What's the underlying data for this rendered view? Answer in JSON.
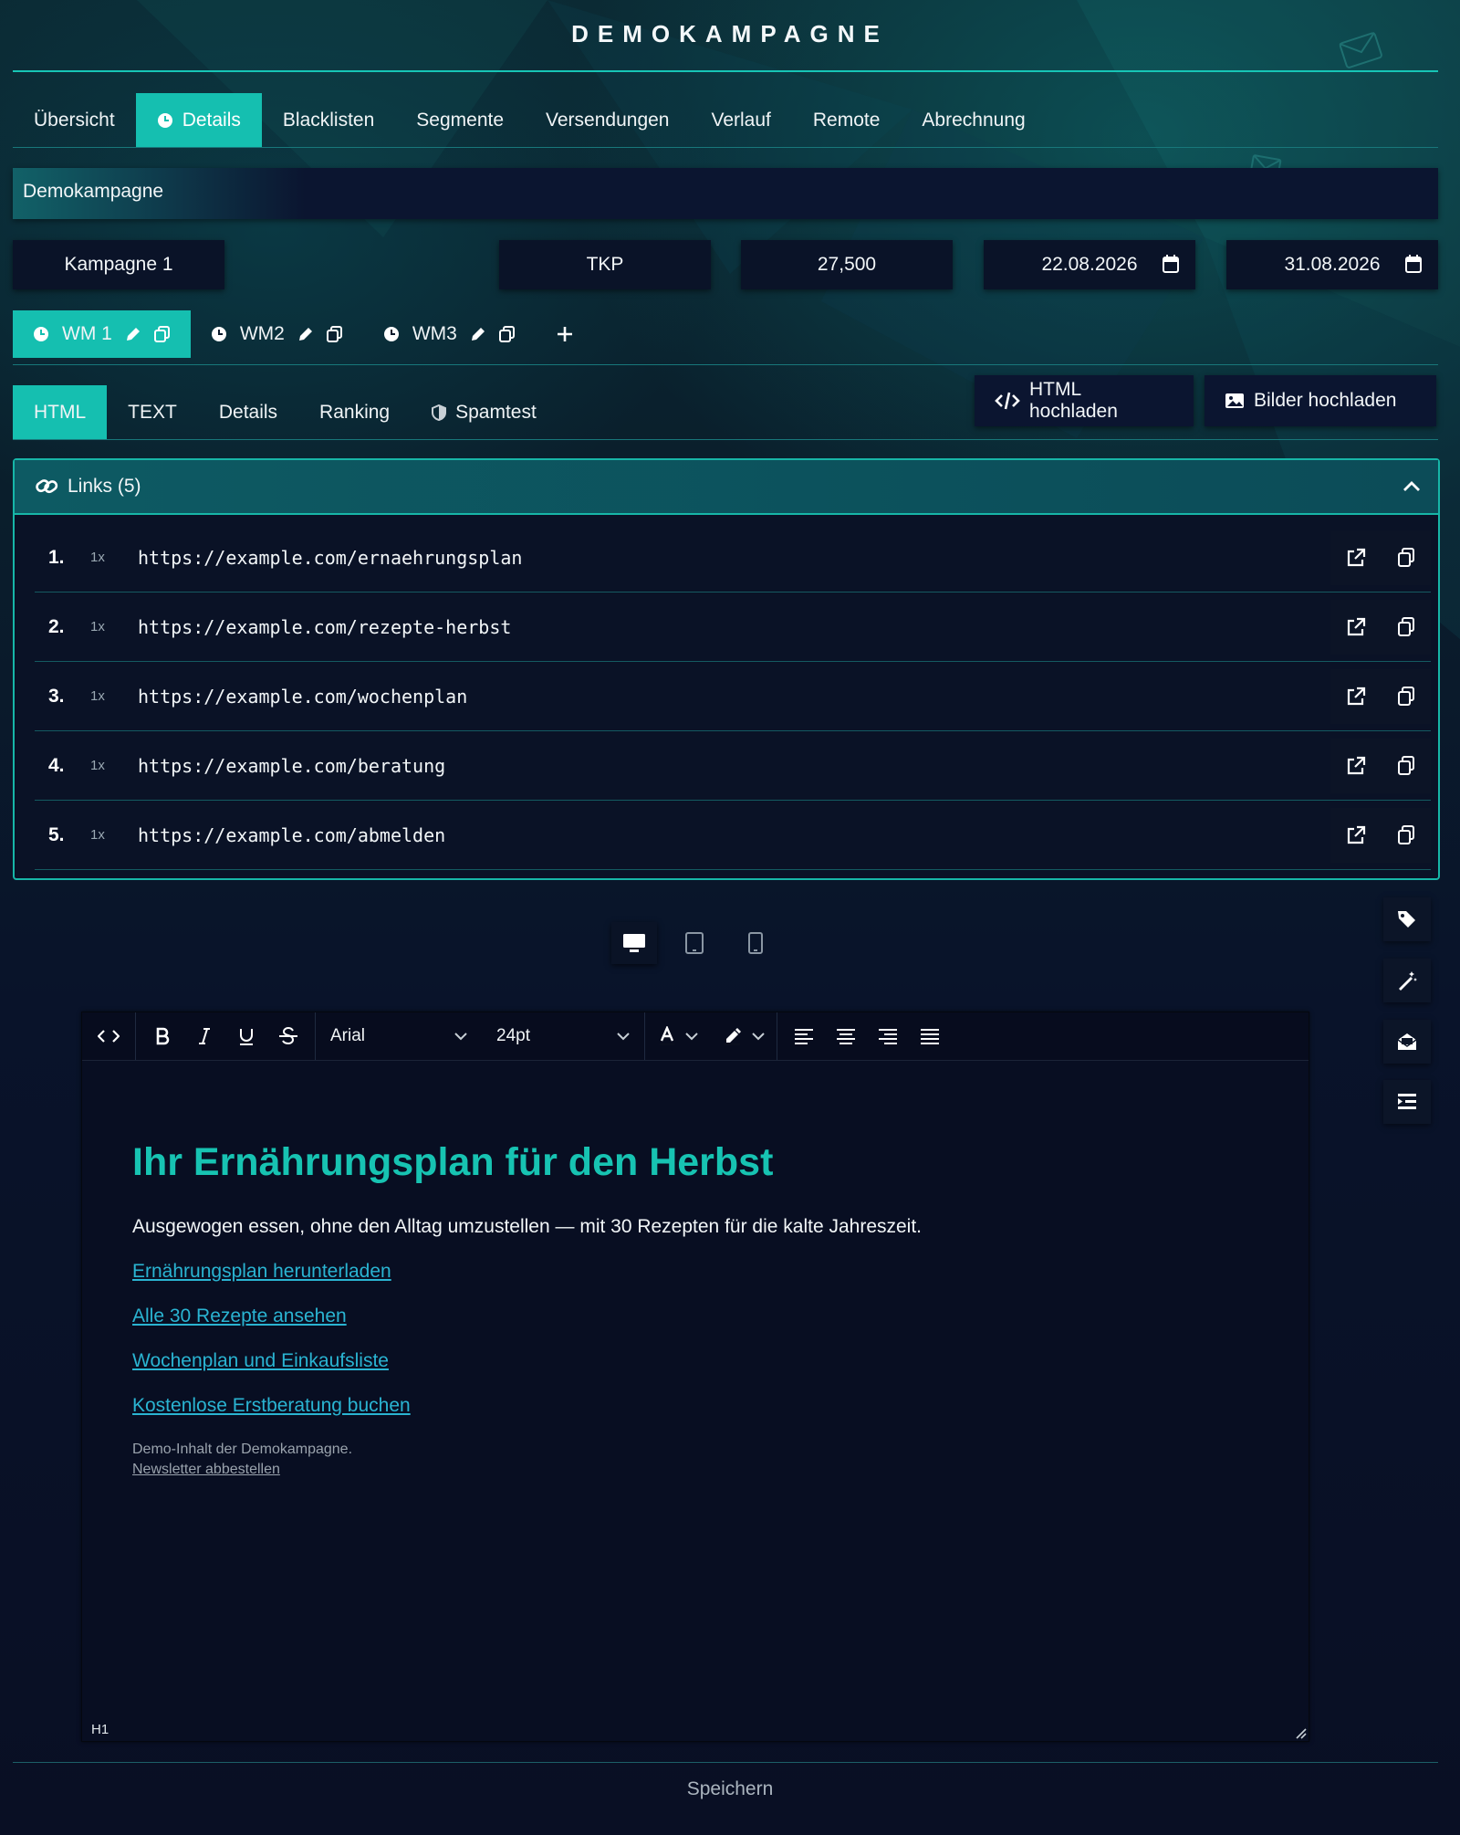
{
  "page": {
    "title": "DEMOKAMPAGNE"
  },
  "main_tabs": [
    {
      "label": "Übersicht",
      "active": false
    },
    {
      "label": "Details",
      "active": true,
      "icon": "clock-icon"
    },
    {
      "label": "Blacklisten",
      "active": false
    },
    {
      "label": "Segmente",
      "active": false
    },
    {
      "label": "Versendungen",
      "active": false
    },
    {
      "label": "Verlauf",
      "active": false
    },
    {
      "label": "Remote",
      "active": false
    },
    {
      "label": "Abrechnung",
      "active": false
    }
  ],
  "campaign": {
    "name": "Demokampagne",
    "label": "Kampagne 1",
    "billing_type": "TKP",
    "volume": "27,500",
    "start_date": "22.08.2026",
    "end_date": "31.08.2026"
  },
  "mailings": [
    {
      "label": "WM 1",
      "active": true
    },
    {
      "label": "WM2",
      "active": false
    },
    {
      "label": "WM3",
      "active": false
    }
  ],
  "content_tabs": [
    {
      "label": "HTML",
      "active": true
    },
    {
      "label": "TEXT",
      "active": false
    },
    {
      "label": "Details",
      "active": false
    },
    {
      "label": "Ranking",
      "active": false
    },
    {
      "label": "Spamtest",
      "active": false,
      "icon": "shield-icon"
    }
  ],
  "upload": {
    "html_label": "HTML hochladen",
    "images_label": "Bilder hochladen"
  },
  "links": {
    "header": "Links (5)",
    "items": [
      {
        "num": "1.",
        "count": "1x",
        "url": "https://example.com/ernaehrungsplan"
      },
      {
        "num": "2.",
        "count": "1x",
        "url": "https://example.com/rezepte-herbst"
      },
      {
        "num": "3.",
        "count": "1x",
        "url": "https://example.com/wochenplan"
      },
      {
        "num": "4.",
        "count": "1x",
        "url": "https://example.com/beratung"
      },
      {
        "num": "5.",
        "count": "1x",
        "url": "https://example.com/abmelden"
      }
    ]
  },
  "editor": {
    "font": "Arial",
    "size": "24pt",
    "status": "H1",
    "heading": "Ihr Ernährungsplan für den Herbst",
    "paragraph": "Ausgewogen essen, ohne den Alltag umzustellen — mit 30 Rezepten für die kalte Jahreszeit.",
    "links": [
      "Ernährungsplan herunterladen",
      "Alle 30 Rezepte ansehen",
      "Wochenplan und Einkaufsliste",
      "Kostenlose Erstberatung buchen"
    ],
    "footer_text": "Demo-Inhalt der Demokampagne.",
    "unsubscribe": "Newsletter abbestellen"
  },
  "save_label": "Speichern",
  "colors": {
    "accent": "#15bfb0",
    "link": "#2ab4d2",
    "background": "#090f24"
  }
}
